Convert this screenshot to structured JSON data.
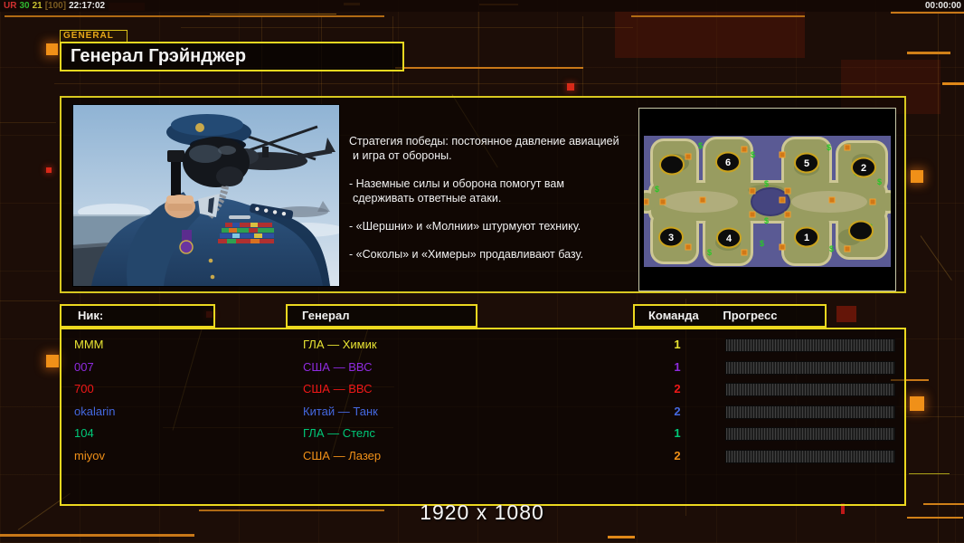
{
  "status_bar": {
    "left": {
      "tag": "UR",
      "val1": "30",
      "val2": "21",
      "bracket": "[100]",
      "clock": "22:17:02"
    },
    "right_timer": "00:00:00",
    "colors": {
      "tag": "#d03030",
      "val1": "#30b830",
      "val2": "#c8c030",
      "bracket": "#7a5a20",
      "clock": "#e8e8e8"
    }
  },
  "general_panel": {
    "tab_label": "GENERAL",
    "title": "Генерал Грэйнджер",
    "strategy": [
      [
        "Стратегия победы: постоянное давление авиацией",
        "и игра от обороны."
      ],
      [
        "- Наземные силы и оборона помогут вам",
        "сдерживать ответные атаки."
      ],
      [
        "- «Шершни» и «Молнии» штурмуют технику."
      ],
      [
        "- «Соколы» и «Химеры» продавливают базу."
      ]
    ]
  },
  "map": {
    "start_numbers": [
      "6",
      "5",
      "2",
      "3",
      "4",
      "1"
    ],
    "money_symbol": "$",
    "water_color": "#5a5a94",
    "land_color": "#989c60"
  },
  "table": {
    "headers": {
      "nick": "Ник:",
      "general": "Генерал",
      "team": "Команда",
      "progress": "Прогресс"
    },
    "players": [
      {
        "nick": "MMM",
        "general": "ГЛА — Химик",
        "team": "1",
        "color": "#e8e433"
      },
      {
        "nick": "007",
        "general": "США — ВВС",
        "team": "1",
        "color": "#8f2be0"
      },
      {
        "nick": "700",
        "general": "США — ВВС",
        "team": "2",
        "color": "#f01818"
      },
      {
        "nick": "okalarin",
        "general": "Китай — Танк",
        "team": "2",
        "color": "#4468e0"
      },
      {
        "nick": "104",
        "general": "ГЛА — Стелс",
        "team": "1",
        "color": "#00c878"
      },
      {
        "nick": "miyov",
        "general": "США — Лазер",
        "team": "2",
        "color": "#f09018"
      }
    ]
  },
  "footer": {
    "resolution": "1920 x 1080"
  },
  "theme": {
    "border_yellow": "#e8d820",
    "accent_orange": "#f09018"
  }
}
